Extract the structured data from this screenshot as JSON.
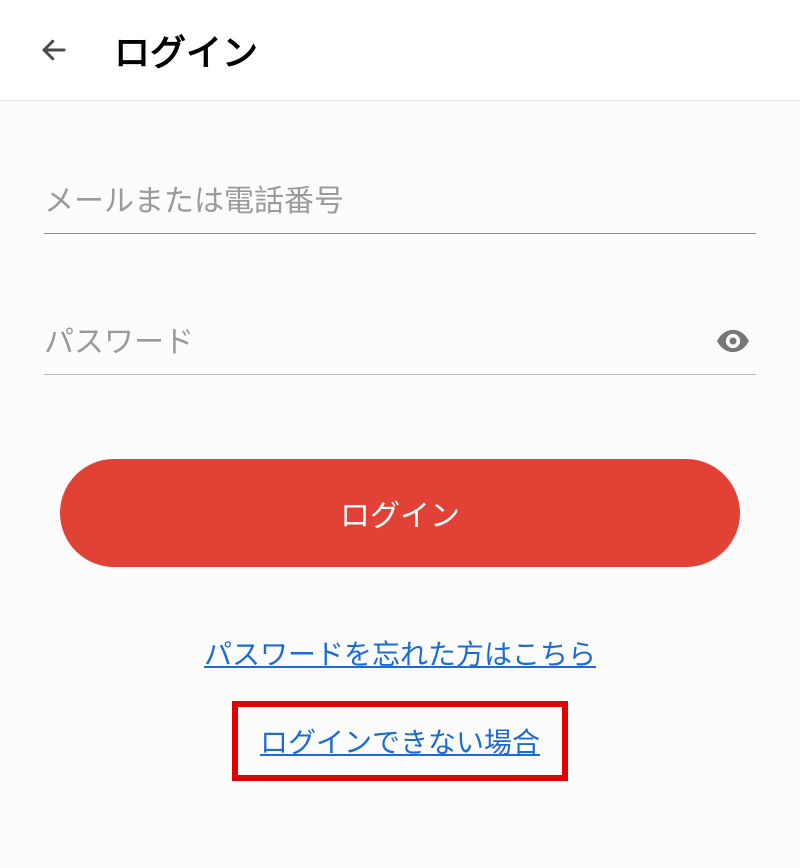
{
  "header": {
    "title": "ログイン"
  },
  "form": {
    "email_placeholder": "メールまたは電話番号",
    "password_placeholder": "パスワード",
    "login_button_label": "ログイン"
  },
  "links": {
    "forgot_password": "パスワードを忘れた方はこちら",
    "cannot_login": "ログインできない場合"
  },
  "icons": {
    "back": "back-arrow",
    "eye": "visibility-eye"
  },
  "colors": {
    "primary_button": "#e24236",
    "link": "#1a6bd6",
    "highlight_border": "#e20000"
  }
}
